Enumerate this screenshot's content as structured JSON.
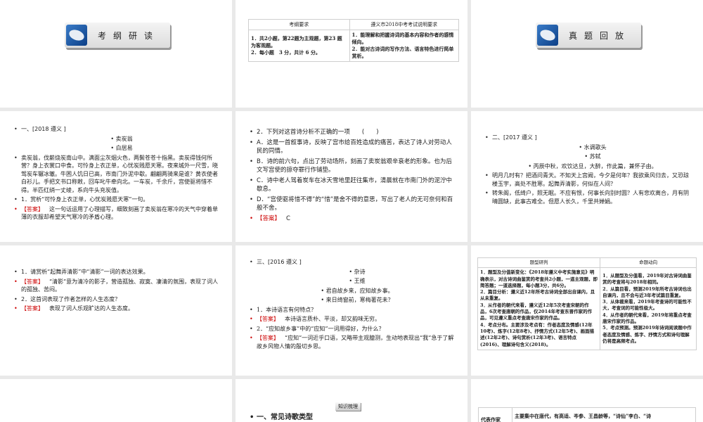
{
  "slide1": {
    "banner": "考纲研读"
  },
  "slide2": {
    "headers": [
      "考纲要求",
      "遵义市2018中考考试说明要求"
    ],
    "left": [
      "1．共2小题，第22题为主观题，第23 题为客观题。",
      "2．每小题　3 分，共计 6 分。"
    ],
    "right": [
      "1．能理解和把握诗词的基本内容和作者的感情倾向。",
      "2．能对古诗词的写作方法、语言特色进行简单赏析。"
    ]
  },
  "slide3": {
    "banner": "真题回放"
  },
  "slide4": {
    "heading": "一、[2018 遵义 ]",
    "title": "卖炭翁",
    "author": "白居易",
    "poem": "卖炭翁，伐薪烧炭南山中。满面尘灰烟火色，两鬓苍苍十指黑。卖炭得钱何所营？身上衣裳口中食。可怜身上衣正单，心忧炭贱愿天寒。夜来城外一尺雪，晓驾炭车辗冰辙。牛困人饥日已高，市南门外泥中歇。翩翩两骑来是谁？黄衣使者白衫儿。手把文书口称敕，回车叱牛牵向北。一车炭，千余斤，宫使驱将惜不得。半匹红绡一丈绫，系向牛头充炭值。",
    "q1": "1．赏析“可怜身上衣正单，心忧炭贱愿天寒”一句。",
    "answer_label": "【答案】",
    "a1": "这一句话运用了心理描写，细致刻画了卖炭翁在寒冷的天气中穿着单薄的衣服却希望天气寒冷的矛盾心理。"
  },
  "slide5": {
    "q2": "2．下列对这首诗分析不正确的一项　　(　　)",
    "options": [
      "A．这是一首叙事诗，反映了宫市给百姓造成的痛苦，表达了诗人对劳动人民的同情。",
      "B．诗的前六句，点出了劳动场所，刻画了卖炭翁艰辛衰老的形象。也为后文写宫使的掠夺罪行作铺垫。",
      "C．诗中老人驾着炭车在冰天雪地里赶往集市，清晨就在市南门外的泥泞中歇息。",
      "D．“宫使驱将惜不得”的“惜”是舍不得的意思，写出了老人的无可奈何和百般不舍。"
    ],
    "answer_label": "【答案】",
    "answer": "C"
  },
  "slide6": {
    "heading": "二、[2017 遵义 ]",
    "title": "水调歌头",
    "author": "苏轼",
    "preface": "丙辰中秋，欢饮达旦，大醉，作此篇，兼怀子由。",
    "lines": [
      "明月几时有？把酒问青天。不知天上宫阙，今夕是何年？我欲乘风归去，又恐琼楼玉宇，高处不胜寒。起舞弄清影，何似在人间？",
      "转朱阁，低绮户，照无眠。不应有恨，何事长向别时圆？人有悲欢离合，月有阴晴圆缺，此事古难全。但愿人长久，千里共婵娟。"
    ]
  },
  "slide7": {
    "q1": "1．请赏析“起舞弄清影”中“清影”一词的表达效果。",
    "answer_label": "【答案】",
    "a1": "“清影”意为清冷的影子，营造孤独、寂寞、凄清的氛围，表现了词人的孤独、苦闷。",
    "q2": "2．这首词表现了作者怎样的人生态度？",
    "a2": "表现了词人乐观旷达的人生态度。"
  },
  "slide8": {
    "heading": "三、[2016 遵义 ]",
    "title": "杂诗",
    "author": "王维",
    "lines": [
      "君自故乡来，应知故乡事。",
      "来日绮窗前，寒梅著花未？"
    ],
    "q1": "1．本诗语言有何特点？",
    "answer_label": "【答案】",
    "a1": "本诗语言质朴、平淡，却又韵味无穷。",
    "q2": "2．“应知故乡事”中的“应知”一词用得好，为什么？",
    "a2": "“应知”一词近乎口语，又略带主观臆测，生动地表现出“我”急于了解故乡风物人情的殷切乡思。"
  },
  "slide9": {
    "headers": [
      "题型研判",
      "命题动向"
    ],
    "left": [
      "1．题型及分值新变化：《2018年遵义中考实施意见》明确表示，对古诗词曲鉴赏的考查共2小题，一道主观题，即简答题；一道选择题，每小题3分，共6分。",
      "2．篇目分析：遵义近12年所考古诗词全部出自课内，且从未重复。",
      "3．从作者的朝代来看，遵义近12年5次考查宋朝的作品，6次考查唐朝的作品，仅2014年考查东晋作家的作品，可见遵义重点考查唐宋作家的作品。",
      "4．考点分布。主要涉及考点有：作者态度及情感(12年10考)、炼字(12年8考)、抒情方式(12年5考)、画面描述(12年2考)、诗句赏析(12年3考)、语言特点(2016)、理解诗句含义(2018)。"
    ],
    "right": [
      "1．从题型及分值看，2019年对古诗词曲鉴赏的考查将与2018年相同。",
      "2．从篇目看，预测2019年所考古诗词也出自课内，且不会与近3年考试篇目重复。",
      "3．从体裁来看，2019年考查诗的可能性不大，考查词的可能性极大。",
      "4．从作者的朝代来看，2019年将重点考查唐宋作家的作品。",
      "5．考点预测。预测2019年诗词阅读题中作者态度及情感、炼字、抒情方式和诗句理解仍将是高频考点。"
    ]
  },
  "slide11": {
    "tag": "知识梳理",
    "heading": "一、常见诗歌类型"
  },
  "slide12": {
    "label": "代表作家",
    "text": "主要集中在唐代，有高适、岑参、王昌龄等，“诗仙”李白、“诗"
  }
}
